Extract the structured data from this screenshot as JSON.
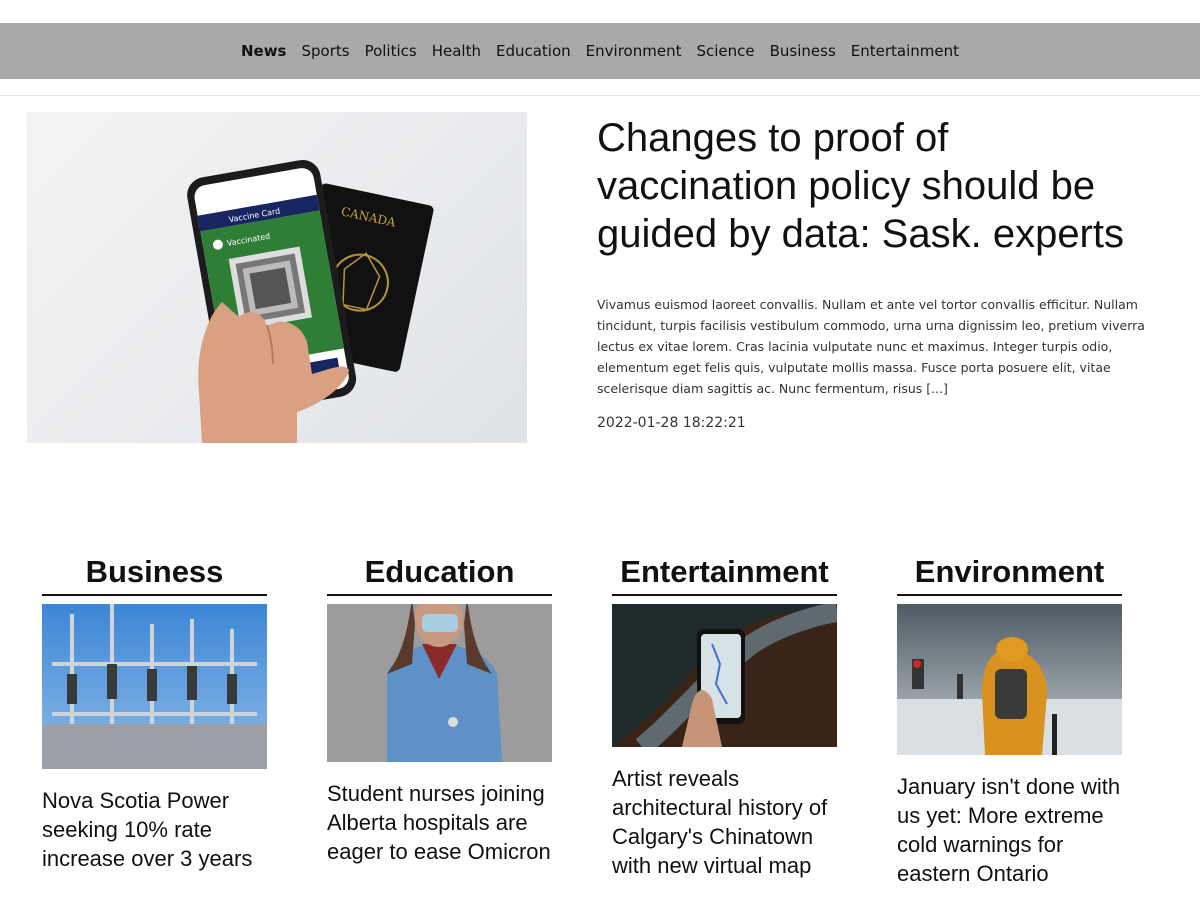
{
  "nav": {
    "items": [
      "News",
      "Sports",
      "Politics",
      "Health",
      "Education",
      "Environment",
      "Science",
      "Business",
      "Entertainment"
    ],
    "active": "News"
  },
  "hero": {
    "title": "Changes to proof of vaccination policy should be guided by data: Sask. experts",
    "excerpt": "Vivamus euismod laoreet convallis. Nullam et ante vel tortor convallis efficitur. Nullam tincidunt, turpis facilisis vestibulum commodo, urna urna dignissim leo, pretium viverra lectus ex vitae lorem. Cras lacinia vulputate nunc et maximus. Integer turpis odio, elementum eget felis quis, vulputate mollis massa. Fusce porta posuere elit, vitae scelerisque diam sagittis ac. Nunc fermentum, risus [...]",
    "date": "2022-01-28 18:22:21",
    "phone_card_title": "Vaccine Card",
    "phone_card_status": "Vaccinated",
    "passport_label": "CANADA"
  },
  "columns": [
    {
      "category": "Business",
      "headline": "Nova Scotia Power seeking 10% rate increase over 3 years"
    },
    {
      "category": "Education",
      "headline": "Student nurses joining Alberta hospitals are eager to ease Omicron"
    },
    {
      "category": "Entertainment",
      "headline": "Artist reveals architectural history of Calgary's Chinatown with new virtual map"
    },
    {
      "category": "Environment",
      "headline": "January isn't done with us yet: More extreme cold warnings for eastern Ontario"
    }
  ]
}
